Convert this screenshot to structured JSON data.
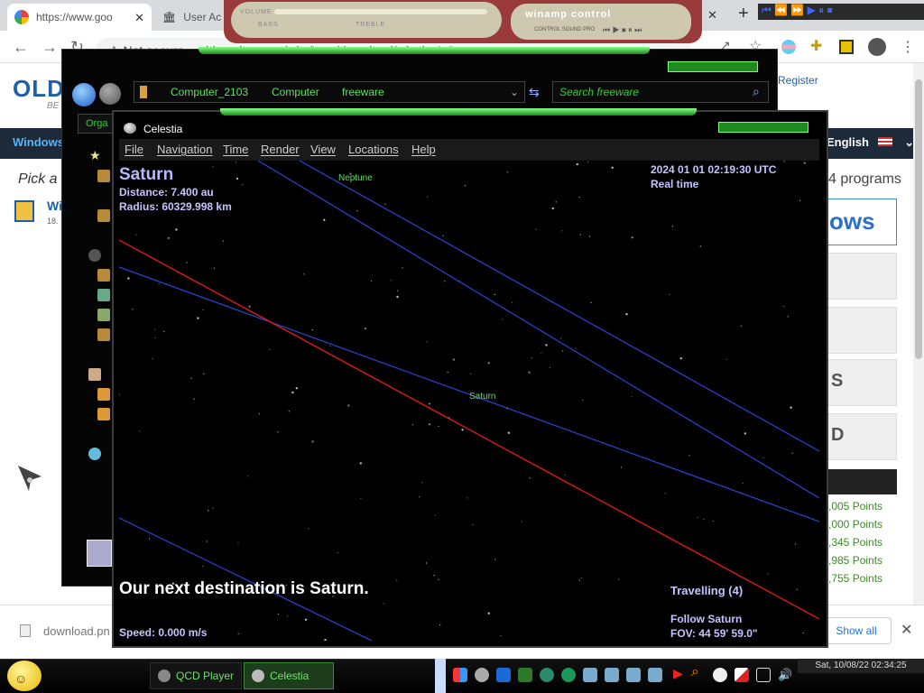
{
  "browser": {
    "tabs": [
      {
        "label": "https://www.goo",
        "icon": "google-icon"
      },
      {
        "label": "User Ac",
        "icon": "bank-icon"
      }
    ],
    "address": {
      "security_label": "Not secure",
      "url": "oldversion.com/windows/download/winzip-1-9"
    }
  },
  "website": {
    "logo": "OLD",
    "logo_sub": "BE",
    "nav_windows": "Windows",
    "register": "Register",
    "language": "English",
    "pick": "Pick a",
    "programs": "4 programs",
    "ows": "ows",
    "side_letters": [
      "S",
      "D"
    ],
    "points": [
      ",005 Points",
      ",000 Points",
      ",345 Points",
      ",985 Points",
      ",755 Points"
    ],
    "app_item": "Wi",
    "app_item_sub": "18."
  },
  "download_bar": {
    "file": "download.pn",
    "show_all": "Show all"
  },
  "winamp": {
    "volume_label": "VOLUME",
    "bass_label": "BASS",
    "treble_label": "TREBLE",
    "control_title": "winamp control",
    "control_sub": "CONTROL SOUND PRO"
  },
  "explorer": {
    "breadcrumbs": [
      "Computer_2103",
      "Computer",
      "freeware"
    ],
    "search_placeholder": "Search freeware",
    "organize": "Orga"
  },
  "celestia": {
    "window_title": "Celestia",
    "menu": [
      "File",
      "Navigation",
      "Time",
      "Render",
      "View",
      "Locations",
      "Help"
    ],
    "object_name": "Saturn",
    "distance": "Distance: 7.400 au",
    "radius": "Radius: 60329.998 km",
    "datetime": "2024 01 01 02:19:30 UTC",
    "time_mode": "Real time",
    "message": "Our next destination is Saturn.",
    "speed": "Speed: 0.000 m/s",
    "travelling": "Travelling (4)",
    "follow": "Follow Saturn",
    "fov": "FOV: 44 59' 59.0\"",
    "labels": {
      "neptune": "Neptune",
      "saturn": "Saturn"
    }
  },
  "taskbar": {
    "tasks": [
      "QCD Player",
      "Celestia"
    ],
    "clock": "Sat, 10/08/22 02:34:25"
  },
  "colors": {
    "orbit_red": "#e01818",
    "orbit_blue": "#2846d8",
    "label_green": "#5de05d",
    "hud_text": "#c4c4ff"
  }
}
